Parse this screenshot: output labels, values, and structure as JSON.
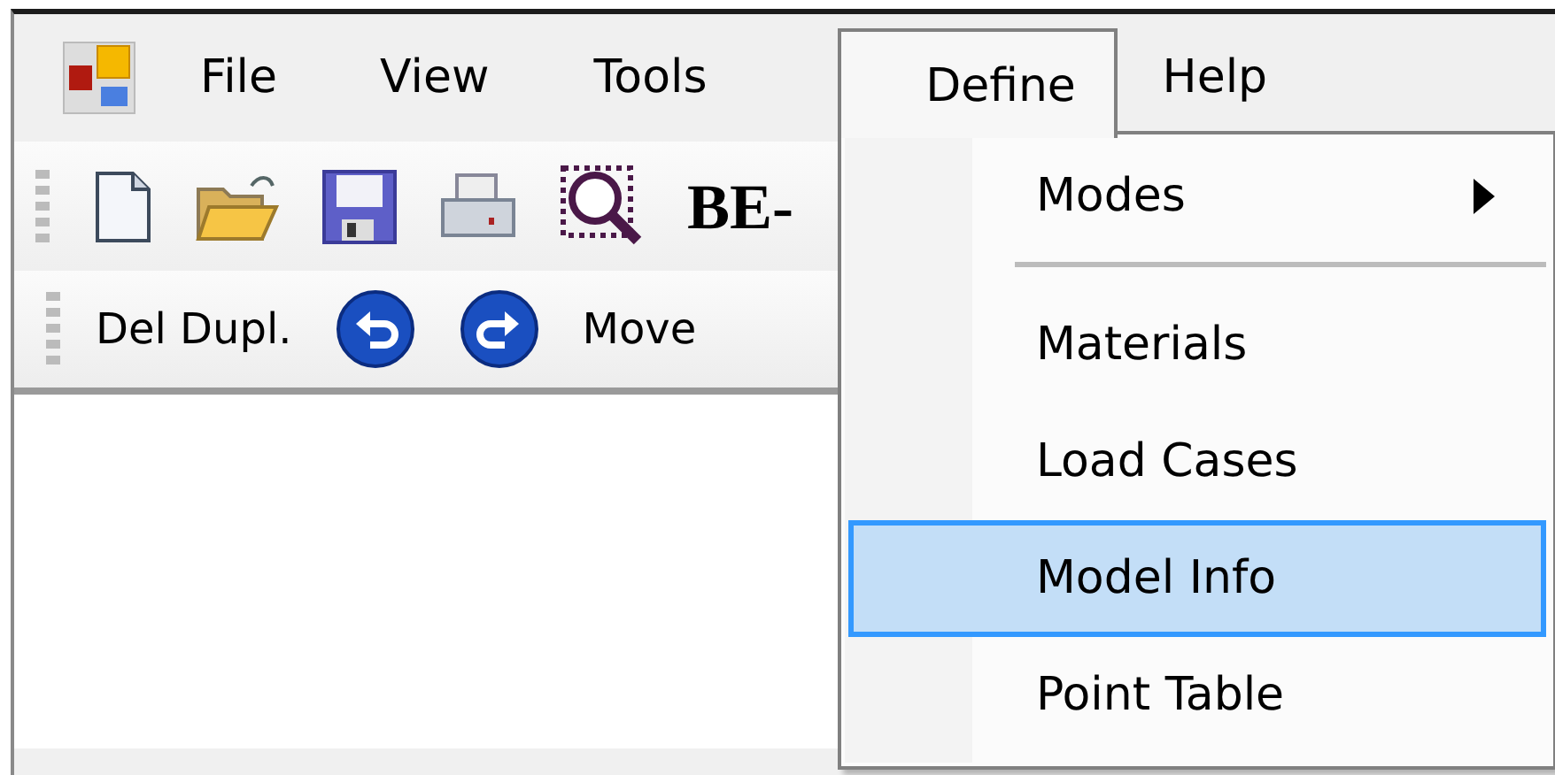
{
  "menu_bar": {
    "items": [
      {
        "label": "File",
        "open": false
      },
      {
        "label": "View",
        "open": false
      },
      {
        "label": "Tools",
        "open": false
      },
      {
        "label": "Define",
        "open": true
      },
      {
        "label": "Help",
        "open": false
      }
    ]
  },
  "toolbar_1": {
    "label": "BE-"
  },
  "toolbar_2": {
    "items": [
      {
        "kind": "text",
        "label": "Del Dupl."
      },
      {
        "kind": "undo"
      },
      {
        "kind": "redo"
      },
      {
        "kind": "text",
        "label": "Move"
      }
    ]
  },
  "define_menu": {
    "items": [
      {
        "kind": "item",
        "label": "Modes",
        "submenu": true,
        "selected": false
      },
      {
        "kind": "separator"
      },
      {
        "kind": "item",
        "label": "Materials",
        "submenu": false,
        "selected": false
      },
      {
        "kind": "item",
        "label": "Load Cases",
        "submenu": false,
        "selected": false
      },
      {
        "kind": "item",
        "label": "Model Info",
        "submenu": false,
        "selected": true
      },
      {
        "kind": "item",
        "label": "Point Table",
        "submenu": false,
        "selected": false
      }
    ]
  }
}
